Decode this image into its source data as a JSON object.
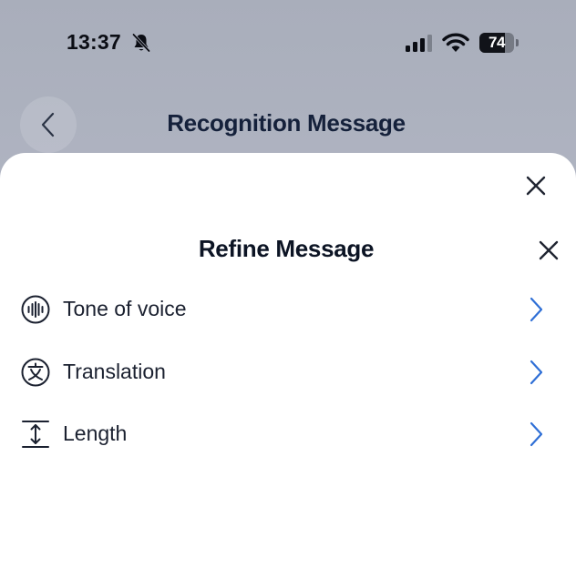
{
  "status_bar": {
    "time": "13:37",
    "battery_level": "74",
    "battery_fraction": 0.74,
    "icons": [
      "bell-slash-icon",
      "cellular-signal-icon",
      "wifi-icon",
      "battery-icon"
    ]
  },
  "header": {
    "back_icon": "chevron-left-icon",
    "title": "Recognition Message"
  },
  "sheet": {
    "close_icon": "close-icon",
    "title": "Refine Message",
    "title_close_icon": "close-icon",
    "options": [
      {
        "label": "Tone of voice",
        "icon": "sound-wave-icon",
        "chevron": "chevron-right-icon"
      },
      {
        "label": "Translation",
        "icon": "translate-icon",
        "chevron": "chevron-right-icon"
      },
      {
        "label": "Length",
        "icon": "text-height-icon",
        "chevron": "chevron-right-icon"
      }
    ]
  },
  "colors": {
    "accent_chevron": "#2f6fd6",
    "backdrop": "#b4b8c6",
    "sheet_background": "#ffffff",
    "title_text": "#15213b"
  }
}
